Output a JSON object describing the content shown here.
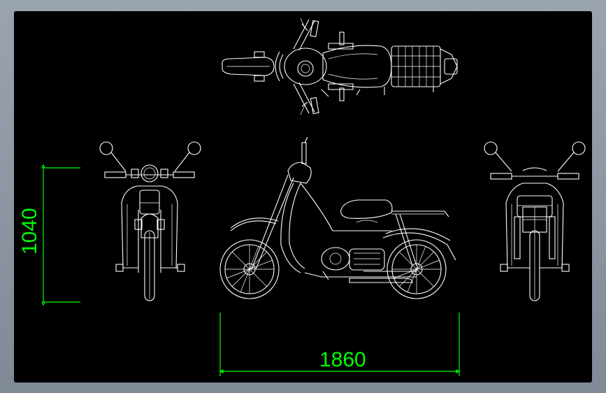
{
  "drawing": {
    "dimension_height": "1040",
    "dimension_length": "1860"
  },
  "colors": {
    "background": "#000000",
    "linework": "#ffffff",
    "dimensions": "#00ff00",
    "frame": "#8a95a1"
  }
}
